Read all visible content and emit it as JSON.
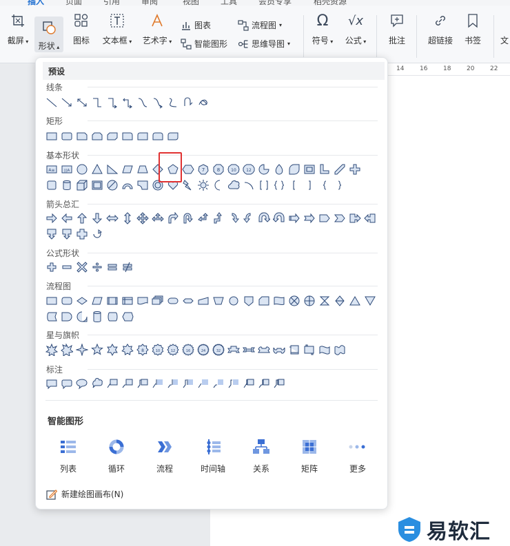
{
  "tabs": [
    {
      "label": "插入",
      "active": true
    },
    {
      "label": "页面",
      "active": false
    },
    {
      "label": "引用",
      "active": false
    },
    {
      "label": "审阅",
      "active": false
    },
    {
      "label": "视图",
      "active": false
    },
    {
      "label": "工具",
      "active": false
    },
    {
      "label": "会员专享",
      "active": false
    },
    {
      "label": "稻壳资源",
      "active": false
    }
  ],
  "ribbon": {
    "screenshot": "截屏",
    "shape": "形状",
    "icon": "图标",
    "textbox": "文本框",
    "wordart": "艺术字",
    "chart": "图表",
    "smartart": "智能图形",
    "flowchart": "流程图",
    "mindmap": "思维导图",
    "symbol": "符号",
    "formula": "公式",
    "comment": "批注",
    "hyperlink": "超链接",
    "bookmark": "书签",
    "more": "文"
  },
  "ruler_ticks": [
    "14",
    "16",
    "18",
    "20",
    "22"
  ],
  "panel": {
    "preset_title": "预设",
    "sections": {
      "lines": "线条",
      "rect": "矩形",
      "basic": "基本形状",
      "arrows": "箭头总汇",
      "formula": "公式形状",
      "flow": "流程图",
      "stars": "星与旗帜",
      "callouts": "标注"
    },
    "basic_text_labels": [
      "A≡",
      "|||A"
    ],
    "number_badges": [
      "7",
      "8",
      "10",
      "12"
    ],
    "star_numbers": [
      "8",
      "10",
      "12",
      "16",
      "24",
      "32"
    ],
    "smart_title": "智能图形",
    "smart_items": [
      "列表",
      "循环",
      "流程",
      "时间轴",
      "关系",
      "矩阵",
      "更多"
    ],
    "new_canvas": "新建绘图画布(N)"
  },
  "watermark": {
    "text": "易软汇"
  },
  "colors": {
    "shape_fill": "#dbe5f3",
    "shape_stroke": "#2e4a78",
    "highlight": "#e03131",
    "accent": "#1f6fd1"
  }
}
